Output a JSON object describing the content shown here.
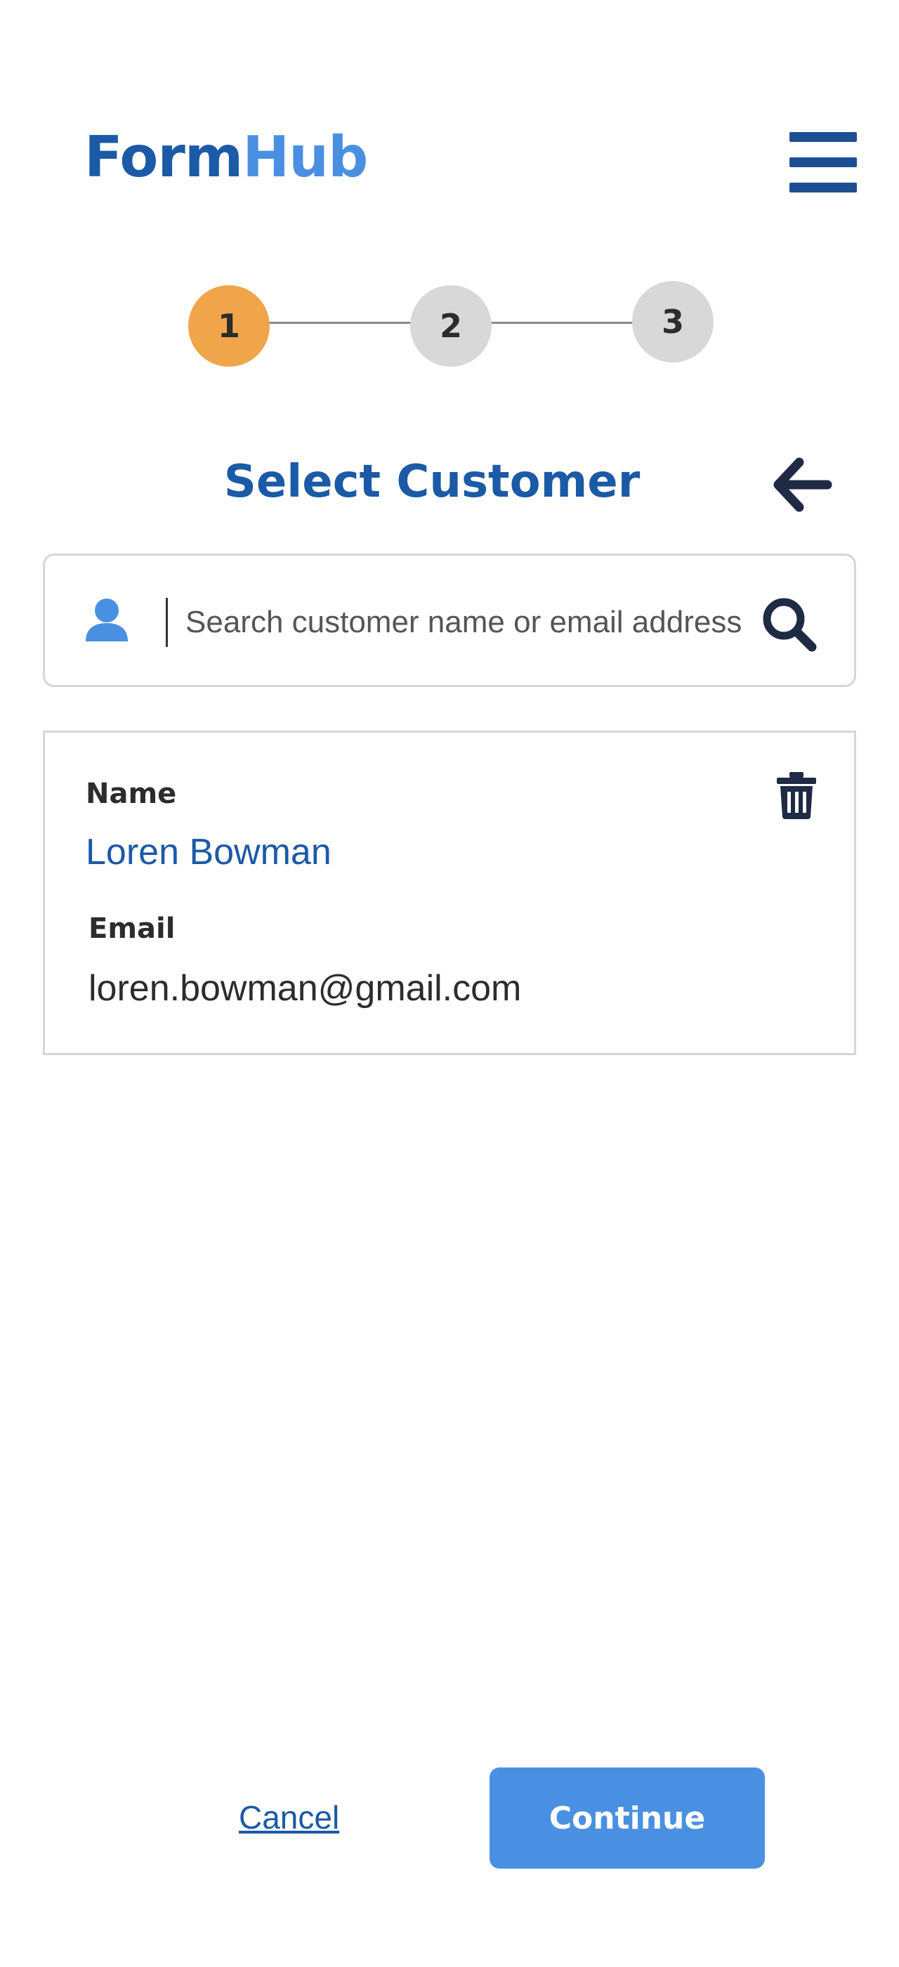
{
  "header": {
    "logo_part1": "Form",
    "logo_part2": "Hub",
    "menu_icon": "hamburger-menu-icon"
  },
  "stepper": {
    "steps": [
      {
        "label": "1",
        "status": "active"
      },
      {
        "label": "2",
        "status": "inactive"
      },
      {
        "label": "3",
        "status": "inactive"
      }
    ],
    "colors": {
      "active": "#f0a54a",
      "inactive": "#d8d8d8",
      "connector": "#8a8a8a"
    }
  },
  "page": {
    "title": "Select Customer",
    "back_icon": "arrow-left-icon"
  },
  "search": {
    "placeholder": "Search customer name or email address",
    "value": "",
    "user_icon": "user-icon",
    "search_icon": "magnifier-icon"
  },
  "customer_card": {
    "name_label": "Name",
    "name_value": "Loren Bowman",
    "email_label": "Email",
    "email_value": "loren.bowman@gmail.com",
    "delete_icon": "trash-icon"
  },
  "actions": {
    "cancel_label": "Cancel",
    "continue_label": "Continue"
  },
  "colors": {
    "brand_dark": "#1b5aa6",
    "brand_light": "#4a90e2",
    "step_active": "#f0a54a",
    "step_inactive": "#d8d8d8",
    "icon_dark": "#1f2a44"
  }
}
